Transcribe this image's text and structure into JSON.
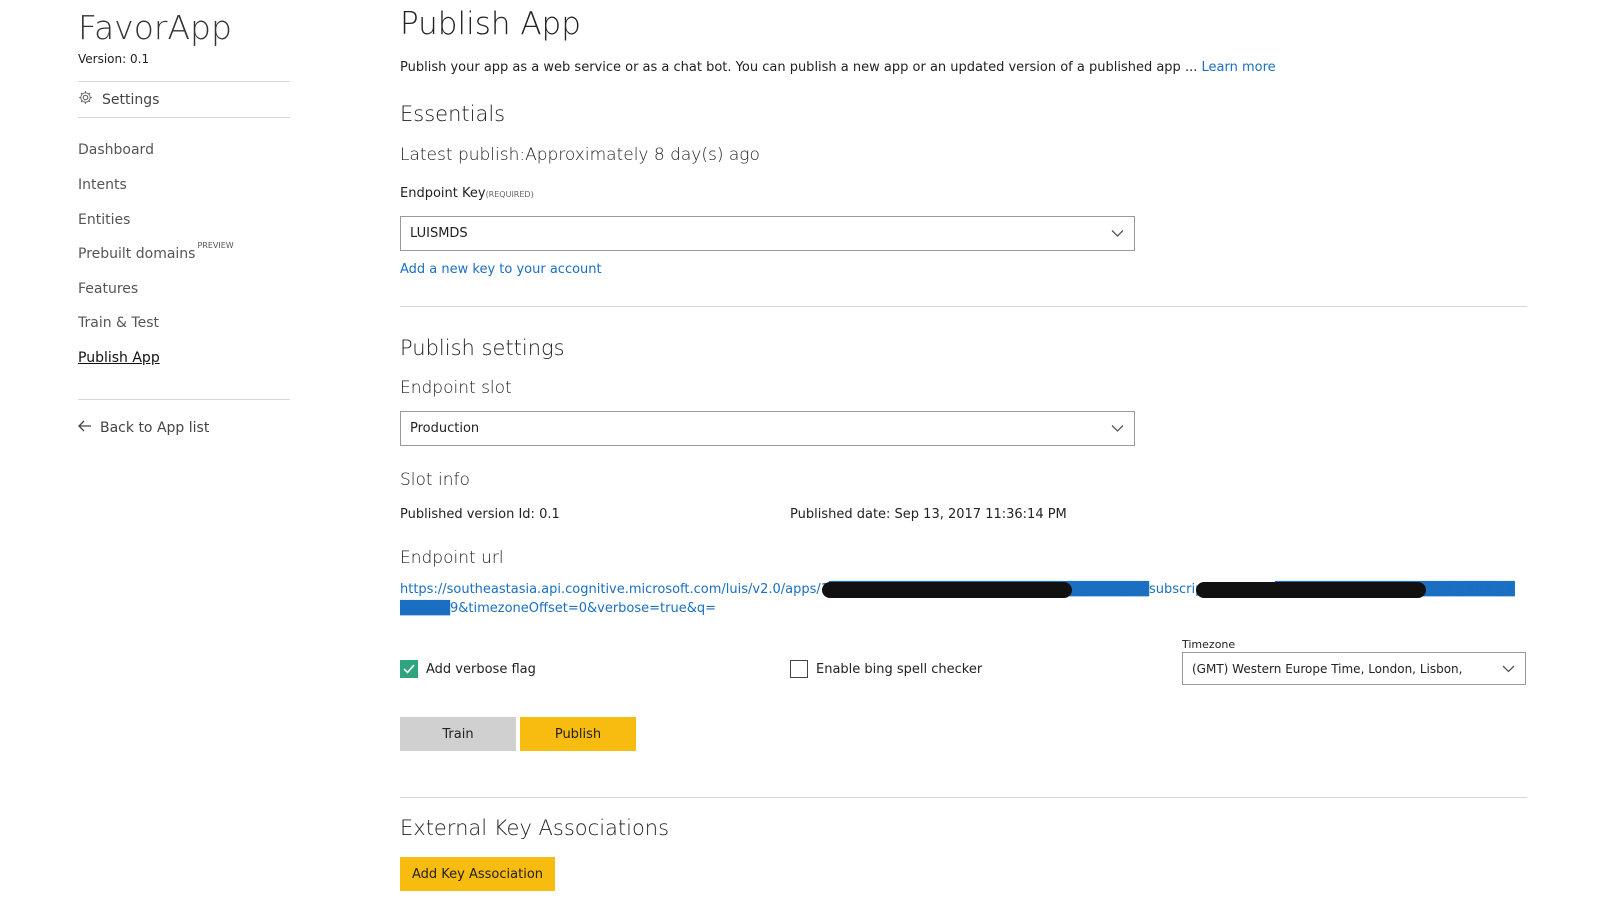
{
  "sidebar": {
    "app_name": "FavorApp",
    "version_label": "Version:",
    "version_value": "0.1",
    "settings_label": "Settings",
    "items": [
      {
        "label": "Dashboard"
      },
      {
        "label": "Intents"
      },
      {
        "label": "Entities"
      },
      {
        "label": "Prebuilt domains",
        "tag": "PREVIEW"
      },
      {
        "label": "Features"
      },
      {
        "label": "Train & Test"
      },
      {
        "label": "Publish App",
        "active": true
      }
    ],
    "back_label": "Back to App list"
  },
  "main": {
    "title": "Publish App",
    "description": "Publish your app as a web service or as a chat bot. You can publish a new app or an updated version of a published app ...",
    "learn_more": "Learn more",
    "essentials": {
      "heading": "Essentials",
      "latest_publish": "Latest publish:Approximately 8 day(s) ago",
      "endpoint_key_label": "Endpoint Key",
      "endpoint_key_required": "(REQUIRED)",
      "endpoint_key_value": "LUISMDS",
      "add_key_link": "Add a new key to your account"
    },
    "publish_settings": {
      "heading": "Publish settings",
      "slot_label": "Endpoint slot",
      "slot_value": "Production",
      "slot_info_heading": "Slot info",
      "published_version": "Published version Id: 0.1",
      "published_date": "Published date: Sep 13, 2017 11:36:14 PM",
      "endpoint_url_heading": "Endpoint url",
      "endpoint_url": "https://southeastasia.api.cognitive.microsoft.com/luis/v2.0/apps/1████████████████████████████████subscription-key=1█████████████████████████████9&timezoneOffset=0&verbose=true&q=",
      "verbose_label": "Add verbose flag",
      "verbose_checked": true,
      "bing_label": "Enable bing spell checker",
      "bing_checked": false,
      "timezone_label": "Timezone",
      "timezone_value": "(GMT) Western Europe Time, London, Lisbon,",
      "train_button": "Train",
      "publish_button": "Publish"
    },
    "external": {
      "heading": "External Key Associations",
      "add_button": "Add Key Association"
    }
  },
  "colors": {
    "accent_yellow": "#f8bb10",
    "train_gray": "#d0d0d0",
    "link_blue": "#1a6fc2",
    "check_green": "#2fa57f"
  }
}
